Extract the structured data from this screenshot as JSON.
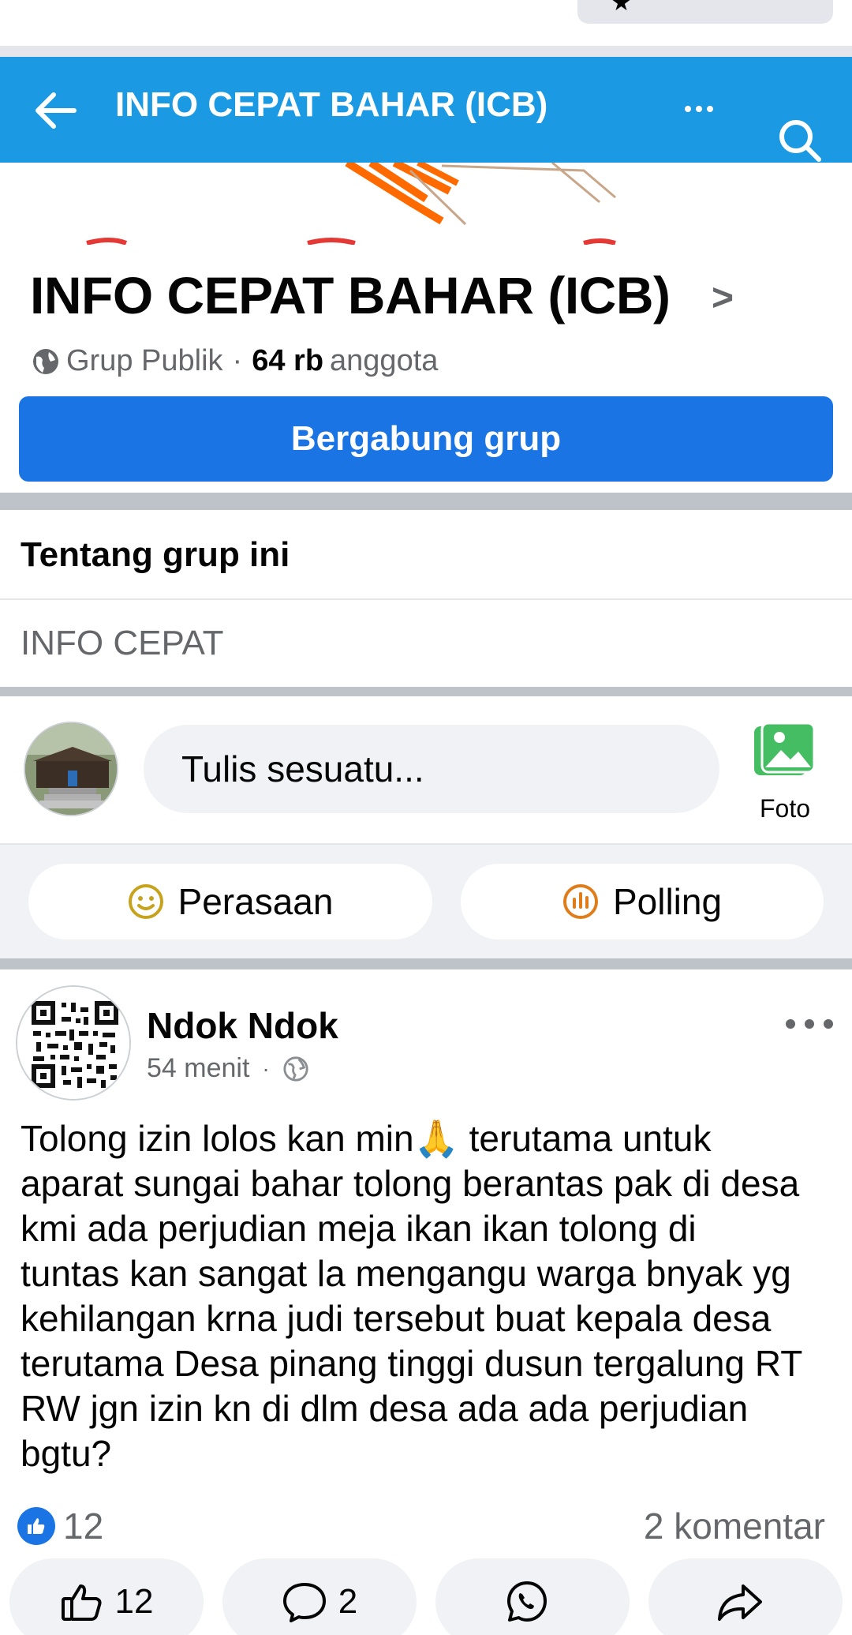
{
  "appbar": {
    "title": "INFO CEPAT BAHAR (ICB)"
  },
  "group": {
    "name": "INFO CEPAT BAHAR (ICB)",
    "chevron": ">",
    "privacy": "Grup Publik",
    "separator": "·",
    "member_count": "64 rb",
    "member_label": "anggota",
    "join_label": "Bergabung grup"
  },
  "about": {
    "title": "Tentang grup ini",
    "description": "INFO CEPAT"
  },
  "composer": {
    "placeholder": "Tulis sesuatu...",
    "photo_label": "Foto"
  },
  "quick_actions": [
    {
      "label": "Perasaan",
      "icon": "smiley-icon"
    },
    {
      "label": "Polling",
      "icon": "poll-icon"
    }
  ],
  "post": {
    "author": "Ndok Ndok",
    "time": "54 menit",
    "meta_separator": "·",
    "text": "Tolong izin lolos kan min🙏 terutama untuk\naparat sungai bahar tolong berantas pak di desa\nkmi ada perjudian meja ikan ikan tolong di\ntuntas kan sangat la mengangu warga bnyak yg\nkehilangan krna judi tersebut buat kepala desa\nterutama Desa pinang tinggi dusun tergalung RT\nRW jgn izin kn di dlm desa ada ada perjudian\nbgtu?",
    "reaction_count": "12",
    "comment_summary": "2 komentar",
    "actions": {
      "like_count": "12",
      "comment_count": "2"
    }
  },
  "colors": {
    "appbar": "#1b9ae3",
    "primary": "#1b74e4",
    "secondary_text": "#65676b",
    "divider": "#bec3c9",
    "photo_icon": "#45bd62",
    "feeling_icon": "#c7a21b",
    "poll_icon": "#e07d1b"
  }
}
